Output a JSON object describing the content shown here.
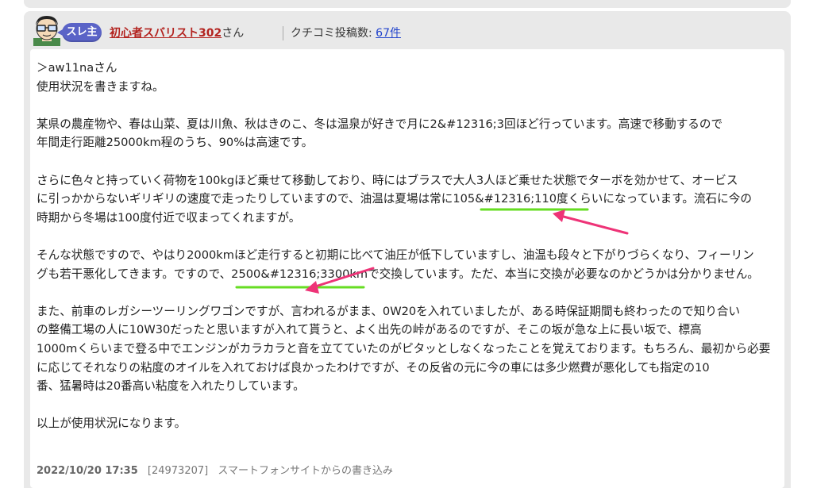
{
  "header": {
    "badge": "スレ主",
    "username": "初心者スバリスト302",
    "san": "さん",
    "kuchikomi_label": "クチコミ投稿数:",
    "kuchikomi_count": "67件"
  },
  "post": {
    "paragraphs": [
      [
        "＞aw11naさん",
        "使用状況を書きますね。"
      ],
      [
        "某県の農産物や、春は山菜、夏は川魚、秋はきのこ、冬は温泉が好きで月に2&#12316;3回ほど行っています。高速で移動するので",
        "年間走行距離25000km程のうち、90%は高速です。"
      ],
      [
        "さらに色々と持っていく荷物を100kgほど乗せて移動しており、時にはブラスで大人3人ほど乗せた状態でターボを効かせて、オービス",
        "に引っかからないギリギリの速度で走ったりしていますので、油温は夏場は常に105&#12316;110度くらいになっています。流石に今の",
        "時期から冬場は100度付近で収まってくれますが。"
      ],
      [
        "そんな状態ですので、やはり2000kmほど走行すると初期に比べて油圧が低下していますし、油温も段々と下がりづらくなり、フィーリン",
        "グも若干悪化してきます。ですので、2500&#12316;3300kmで交換しています。ただ、本当に交換が必要なのかどうかは分かりません。"
      ],
      [
        "また、前車のレガシーツーリングワゴンですが、言われるがまま、0W20を入れていましたが、ある時保証期間も終わったので知り合い",
        "の整備工場の人に10W30だったと思いますが入れて貰うと、よく出先の峠があるのですが、そこの坂が急な上に長い坂で、標高",
        "1000mくらいまで登る中でエンジンがカラカラと音を立てていたのがピタッとしなくなったことを覚えております。もちろん、最初から必要",
        "に応じてそれなりの粘度のオイルを入れておけば良かったわけですが、その反省の元に今の車には多少燃費が悪化しても指定の10",
        "番、猛暑時は20番高い粘度を入れたりしています。"
      ],
      [
        "以上が使用状況になります。"
      ]
    ]
  },
  "footer": {
    "datetime": "2022/10/20 17:35",
    "post_id": "[24973207]",
    "source": "スマートフォンサイトからの書き込み"
  },
  "colors": {
    "badge": "#5a63c7",
    "username": "#b3231f",
    "link": "#2244cc",
    "underline_annotation": "#66dd22",
    "arrow_annotation": "#ee3377"
  }
}
